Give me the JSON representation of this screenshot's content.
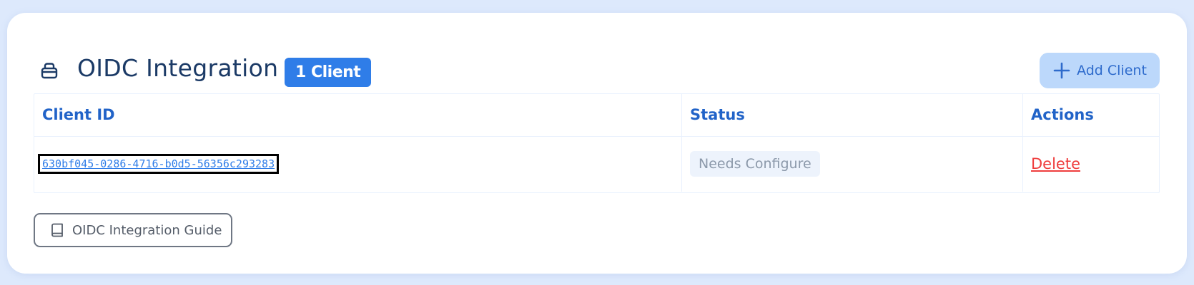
{
  "section": {
    "title": "OIDC Integration",
    "count_badge": "1 Client",
    "title_icon": "lock-icon"
  },
  "actions": {
    "add_client_label": "Add Client",
    "add_client_icon": "plus-icon",
    "guide_label": "OIDC Integration Guide",
    "guide_icon": "book-icon"
  },
  "table": {
    "headers": {
      "client_id": "Client ID",
      "status": "Status",
      "actions": "Actions"
    },
    "rows": [
      {
        "client_id": "630bf045-0286-4716-b0d5-56356c293283",
        "status": "Needs Configure",
        "action": "Delete"
      }
    ]
  },
  "colors": {
    "accent": "#2f7de8",
    "heading": "#2163c8",
    "title": "#1b3a66",
    "danger": "#ef3d3d",
    "page_bg": "#dde9fc"
  }
}
